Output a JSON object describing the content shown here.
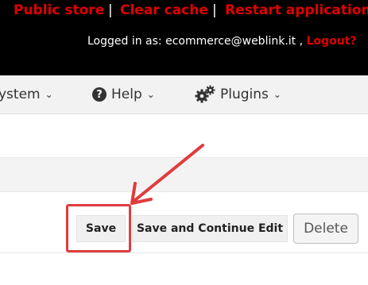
{
  "top_links": {
    "public_store": "Public store",
    "separator": "|",
    "clear_cache": "Clear cache",
    "restart_application": "Restart application"
  },
  "login": {
    "prefix": "Logged in as: ecommerce@weblink.it ,",
    "logout": "Logout?"
  },
  "menu": {
    "system": "ystem",
    "help": "Help",
    "plugins": "Plugins"
  },
  "buttons": {
    "save": "Save",
    "save_continue": "Save and Continue Edit",
    "delete": "Delete"
  },
  "colors": {
    "header_bg": "#000000",
    "link_red": "#e00000",
    "annotation_red": "#e03c3c"
  }
}
